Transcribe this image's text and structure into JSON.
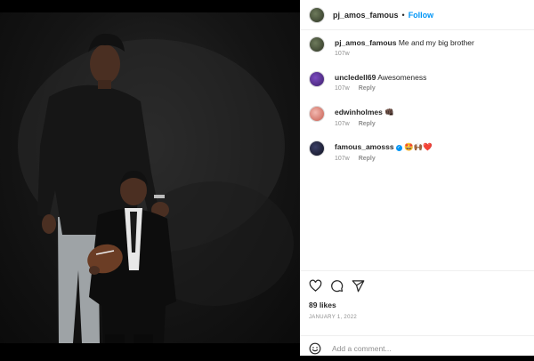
{
  "post": {
    "username": "pj_amos_famous",
    "follow_label": "Follow",
    "separator": "•",
    "caption_user": "pj_amos_famous",
    "caption_text": "Me and my big brother",
    "caption_time": "107w"
  },
  "comments": [
    {
      "user": "uncledell69",
      "text": "Awesomeness",
      "time": "107w",
      "reply": "Reply"
    },
    {
      "user": "edwinholmes",
      "text": "👊🏿",
      "time": "107w",
      "reply": "Reply"
    },
    {
      "user": "famous_amosss",
      "verified": true,
      "text": "🤩🙌🏾❤️",
      "time": "107w",
      "reply": "Reply"
    }
  ],
  "actions": {
    "likes": "89 likes",
    "date": "JANUARY 1, 2022",
    "add_comment_placeholder": "Add a comment..."
  },
  "colors": {
    "link": "#0095f6",
    "muted": "#8e8e8e",
    "text": "#262626"
  },
  "icons": [
    "heart-icon",
    "comment-icon",
    "share-icon",
    "emoji-icon",
    "verified-badge-icon"
  ]
}
